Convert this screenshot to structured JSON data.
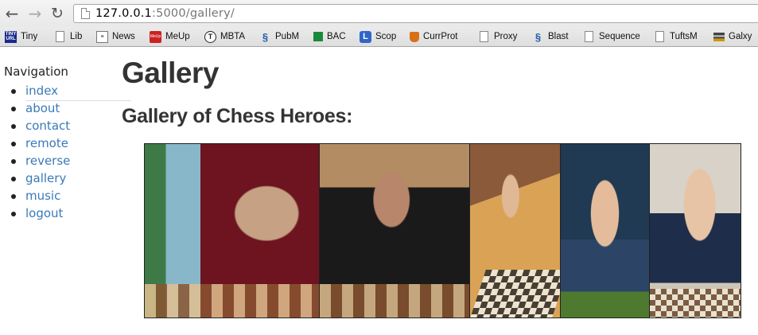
{
  "browser": {
    "url_host": "127.0.0.1",
    "url_path": ":5000/gallery/",
    "bookmarks": [
      {
        "label": "Tiny",
        "icon": "tinyurl-icon"
      },
      {
        "label": "Lib",
        "icon": "page-icon"
      },
      {
        "label": "News",
        "icon": "news-icon"
      },
      {
        "label": "MeUp",
        "icon": "meup-icon"
      },
      {
        "label": "MBTA",
        "icon": "mbta-icon"
      },
      {
        "label": "PubM",
        "icon": "helix-icon"
      },
      {
        "label": "BAC",
        "icon": "green-square-icon"
      },
      {
        "label": "Scop",
        "icon": "scop-icon"
      },
      {
        "label": "CurrProt",
        "icon": "currprot-icon"
      },
      {
        "label": "Proxy",
        "icon": "page-icon"
      },
      {
        "label": "Blast",
        "icon": "helix-icon"
      },
      {
        "label": "Sequence",
        "icon": "page-icon"
      },
      {
        "label": "TuftsM",
        "icon": "page-icon"
      },
      {
        "label": "Galxy",
        "icon": "galaxy-icon"
      }
    ]
  },
  "nav": {
    "title": "Navigation",
    "items": [
      "index",
      "about",
      "contact",
      "remote",
      "reverse",
      "gallery",
      "music",
      "logout"
    ]
  },
  "main": {
    "heading": "Gallery",
    "subheading": "Gallery of Chess Heroes:"
  },
  "gallery": {
    "photos": [
      "chess-player-photo-1",
      "chess-player-photo-2",
      "chess-player-photo-3",
      "chess-player-photo-4",
      "chess-player-photo-5"
    ]
  }
}
